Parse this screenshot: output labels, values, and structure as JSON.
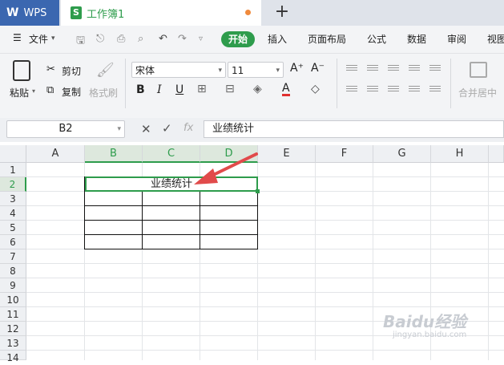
{
  "titlebar": {
    "app_label": "WPS",
    "doc_tab": "工作簿1",
    "doc_icon": "S"
  },
  "menu": {
    "file": "文件",
    "start": "开始",
    "tabs": [
      "插入",
      "页面布局",
      "公式",
      "数据",
      "审阅",
      "视图"
    ]
  },
  "ribbon": {
    "paste": "粘贴",
    "cut": "剪切",
    "copy": "复制",
    "format_painter": "格式刷",
    "font_name": "宋体",
    "font_size": "11",
    "bold": "B",
    "italic": "I",
    "underline": "U",
    "font_color": "A",
    "merge_center": "合并居中"
  },
  "formula_bar": {
    "name_box": "B2",
    "fx": "fx",
    "content": "业绩统计"
  },
  "columns": [
    "A",
    "B",
    "C",
    "D",
    "E",
    "F",
    "G",
    "H"
  ],
  "rows": [
    "1",
    "2",
    "3",
    "4",
    "5",
    "6",
    "7",
    "8",
    "9",
    "10",
    "11",
    "12",
    "13",
    "14"
  ],
  "cells": {
    "B2": "业绩统计"
  },
  "active_cell": "B2",
  "watermark": {
    "brand": "Baidu经验",
    "url": "jingyan.baidu.com"
  },
  "colors": {
    "accent": "#2e9c4c",
    "wps_blue": "#3b67b0",
    "annotation_arrow": "#e14b4b"
  }
}
